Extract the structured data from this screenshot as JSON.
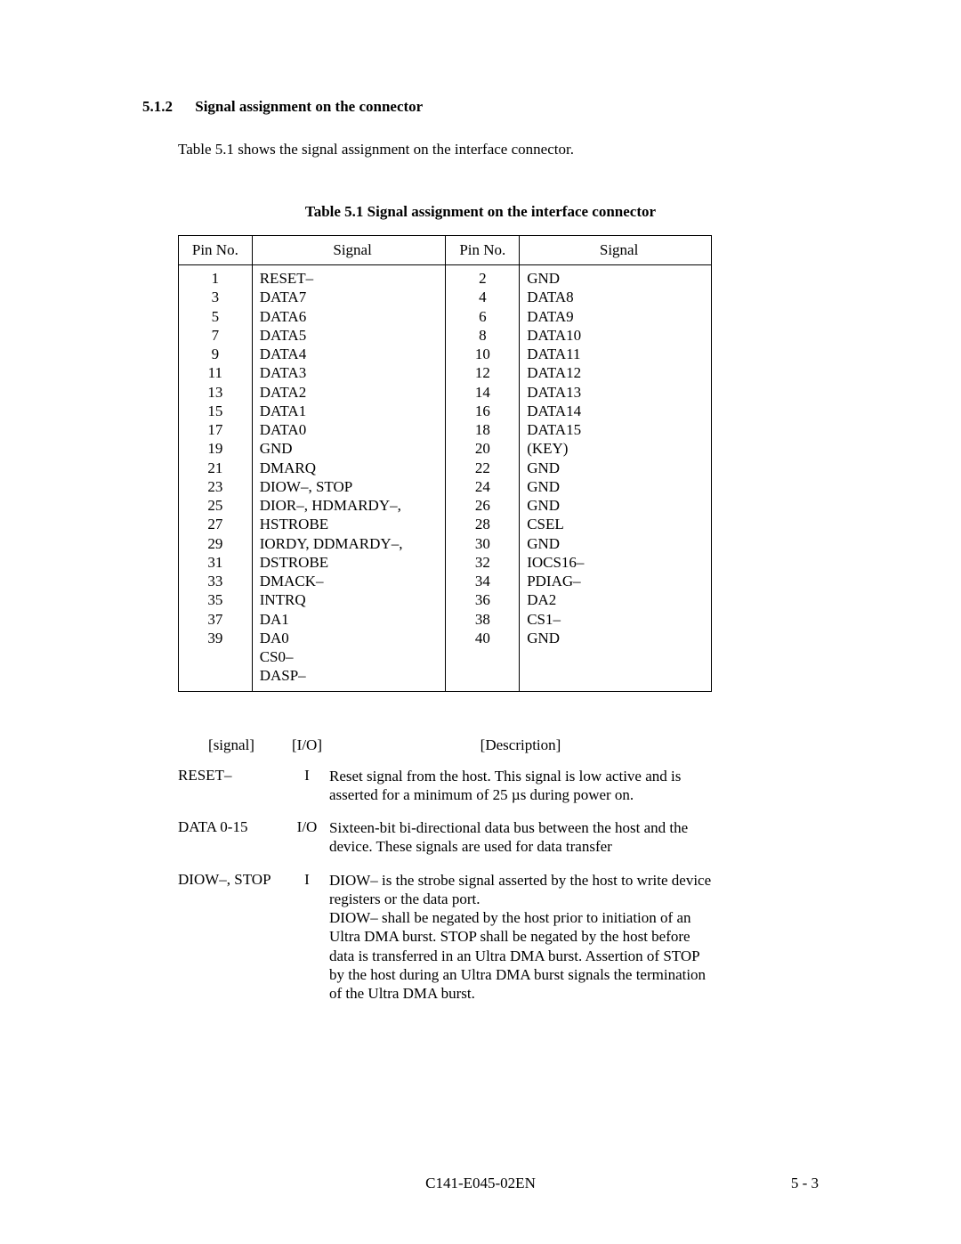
{
  "section": {
    "number": "5.1.2",
    "title": "Signal assignment on the connector"
  },
  "intro": "Table 5.1 shows the signal assignment on the interface connector.",
  "table": {
    "caption": "Table 5.1    Signal assignment on the interface connector",
    "headers": {
      "pin1": "Pin No.",
      "sig1": "Signal",
      "pin2": "Pin No.",
      "sig2": "Signal"
    },
    "rows": [
      {
        "p1": "1",
        "s1": "RESET–",
        "p2": "2",
        "s2": "GND"
      },
      {
        "p1": "3",
        "s1": "DATA7",
        "p2": "4",
        "s2": "DATA8"
      },
      {
        "p1": "5",
        "s1": "DATA6",
        "p2": "6",
        "s2": "DATA9"
      },
      {
        "p1": "7",
        "s1": "DATA5",
        "p2": "8",
        "s2": "DATA10"
      },
      {
        "p1": "9",
        "s1": "DATA4",
        "p2": "10",
        "s2": "DATA11"
      },
      {
        "p1": "11",
        "s1": "DATA3",
        "p2": "12",
        "s2": "DATA12"
      },
      {
        "p1": "13",
        "s1": "DATA2",
        "p2": "14",
        "s2": "DATA13"
      },
      {
        "p1": "15",
        "s1": "DATA1",
        "p2": "16",
        "s2": "DATA14"
      },
      {
        "p1": "17",
        "s1": "DATA0",
        "p2": "18",
        "s2": "DATA15"
      },
      {
        "p1": "19",
        "s1": "GND",
        "p2": "20",
        "s2": "(KEY)"
      },
      {
        "p1": "21",
        "s1": "DMARQ",
        "p2": "22",
        "s2": "GND"
      },
      {
        "p1": "23",
        "s1": "DIOW–, STOP",
        "p2": "24",
        "s2": "GND"
      },
      {
        "p1": "25",
        "s1": "DIOR–, HDMARDY–, HSTROBE",
        "p2": "26",
        "s2": "GND"
      },
      {
        "p1": "27",
        "s1": "IORDY, DDMARDY–,",
        "p2": "28",
        "s2": "CSEL"
      },
      {
        "p1": "29",
        "s1": "DSTROBE",
        "p2": "30",
        "s2": "GND"
      },
      {
        "p1": "31",
        "s1": "DMACK–",
        "p2": "32",
        "s2": "IOCS16–"
      },
      {
        "p1": "33",
        "s1": "INTRQ",
        "p2": "34",
        "s2": "PDIAG–"
      },
      {
        "p1": "35",
        "s1": "DA1",
        "p2": "36",
        "s2": "DA2"
      },
      {
        "p1": "37",
        "s1": "DA0",
        "p2": "38",
        "s2": "CS1–"
      },
      {
        "p1": "39",
        "s1": "CS0–",
        "p2": "40",
        "s2": "GND"
      },
      {
        "p1": "",
        "s1": "DASP–",
        "p2": "",
        "s2": ""
      }
    ]
  },
  "desc": {
    "headers": {
      "signal": "[signal]",
      "io": "[I/O]",
      "description": "[Description]"
    },
    "rows": [
      {
        "signal": "RESET–",
        "io": "I",
        "text": "Reset signal from the host.  This signal is low active and is asserted for a minimum of 25 µs during power on."
      },
      {
        "signal": "DATA 0-15",
        "io": "I/O",
        "text": "Sixteen-bit bi-directional data bus between the host and the device. These signals are used for data transfer"
      },
      {
        "signal": "DIOW–, STOP",
        "io": "I",
        "text": "DIOW– is the strobe signal asserted by the host to write device registers or the data port.\nDIOW– shall be negated by the host prior to initiation of an Ultra DMA burst.  STOP shall be negated by the host before data is transferred in an Ultra DMA burst.  Assertion of STOP by the host during an Ultra DMA burst signals the termination of the Ultra DMA burst."
      }
    ]
  },
  "footer": {
    "center": "C141-E045-02EN",
    "right": "5 - 3"
  }
}
